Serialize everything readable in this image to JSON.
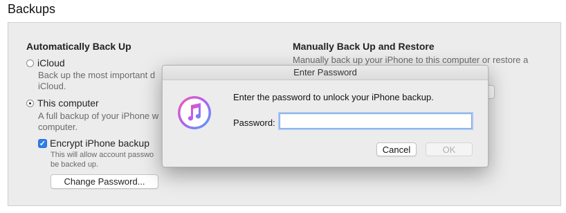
{
  "section_title": "Backups",
  "auto": {
    "title": "Automatically Back Up",
    "icloud_label": "iCloud",
    "icloud_desc_line1": "Back up the most important d",
    "icloud_desc_line2": "iCloud.",
    "computer_label": "This computer",
    "computer_desc_line1": "A full backup of your iPhone w",
    "computer_desc_line2": "computer.",
    "encrypt_label": "Encrypt iPhone backup",
    "encrypt_desc_line1": "This will allow account passwo",
    "encrypt_desc_line2": "be backed up.",
    "change_password_label": "Change Password..."
  },
  "manual": {
    "title": "Manually Back Up and Restore",
    "desc": "Manually back up your iPhone to this computer or restore a"
  },
  "dialog": {
    "title": "Enter Password",
    "prompt": "Enter the password to unlock your iPhone backup.",
    "password_label": "Password:",
    "password_value": "",
    "cancel_label": "Cancel",
    "ok_label": "OK"
  },
  "icons": {
    "itunes": "itunes-note-icon",
    "checkmark": "checkmark-icon"
  },
  "colors": {
    "accent": "#2f7ee8",
    "focus_ring": "#a9c8f3"
  }
}
